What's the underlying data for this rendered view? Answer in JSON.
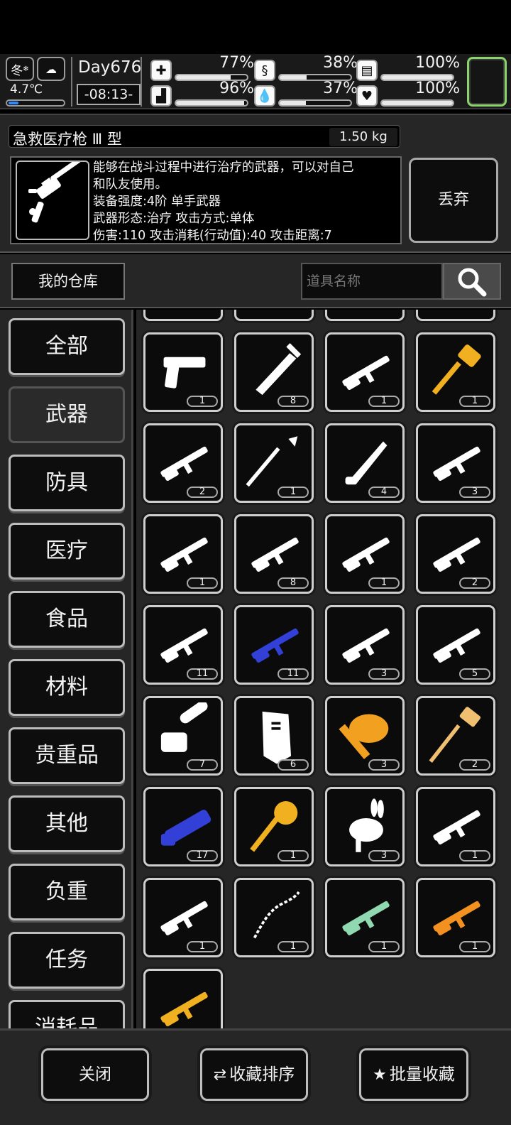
{
  "status": {
    "season": "冬",
    "temperature": "4.7℃",
    "day": "Day676",
    "time": "-08:13-",
    "stats": [
      {
        "icon": "medkit-icon",
        "glyph": "✚",
        "value": "77%",
        "level": 0.77
      },
      {
        "icon": "stomach-icon",
        "glyph": "§",
        "value": "38%",
        "level": 0.38
      },
      {
        "icon": "stamina-icon",
        "glyph": "▤",
        "value": "100%",
        "level": 1.0
      },
      {
        "icon": "boot-icon",
        "glyph": "▟",
        "value": "96%",
        "level": 0.96
      },
      {
        "icon": "water-drop-icon",
        "glyph": "💧",
        "value": "37%",
        "level": 0.37
      },
      {
        "icon": "heart-icon",
        "glyph": "♥",
        "value": "100%",
        "level": 1.0
      }
    ]
  },
  "item": {
    "name": "急救医疗枪 Ⅲ 型",
    "weight": "1.50 kg",
    "description": "能够在战斗过程中进行治疗的武器，可以对自己\n和队友使用。\n装备强度:4阶 单手武器\n武器形态:治疗 攻击方式:单体\n 伤害:110 攻击消耗(行动值):40 攻击距离:7",
    "discard_label": "丢弃"
  },
  "warehouse_label": "我的仓库",
  "search": {
    "placeholder": "道具名称"
  },
  "categories": [
    "全部",
    "武器",
    "防具",
    "医疗",
    "食品",
    "材料",
    "贵重品",
    "其他",
    "负重",
    "任务",
    "消耗品"
  ],
  "active_category": "武器",
  "items": [
    {
      "icon": "pistol-icon",
      "count": "1",
      "color": "#ffffff"
    },
    {
      "icon": "greatsword-icon",
      "count": "8",
      "color": "#ffffff"
    },
    {
      "icon": "rifle-icon",
      "count": "1",
      "color": "#ffffff"
    },
    {
      "icon": "golden-hammer-icon",
      "count": "1",
      "color": "#f0b020"
    },
    {
      "icon": "shotgun-icon",
      "count": "2",
      "color": "#ffffff"
    },
    {
      "icon": "spear-icon",
      "count": "1",
      "color": "#ffffff"
    },
    {
      "icon": "knife-icon",
      "count": "4",
      "color": "#ffffff"
    },
    {
      "icon": "assault-rifle-icon",
      "count": "3",
      "color": "#ffffff"
    },
    {
      "icon": "bolt-rifle-icon",
      "count": "1",
      "color": "#ffffff"
    },
    {
      "icon": "m4-rifle-icon",
      "count": "8",
      "color": "#ffffff"
    },
    {
      "icon": "smg-icon",
      "count": "1",
      "color": "#ffffff"
    },
    {
      "icon": "rocket-launcher-icon",
      "count": "2",
      "color": "#ffffff"
    },
    {
      "icon": "pump-shotgun-icon",
      "count": "11",
      "color": "#ffffff"
    },
    {
      "icon": "sniper-rifle-icon",
      "count": "11",
      "color": "#3340d8"
    },
    {
      "icon": "grenade-launcher-icon",
      "count": "3",
      "color": "#ffffff"
    },
    {
      "icon": "battle-rifle-icon",
      "count": "5",
      "color": "#ffffff"
    },
    {
      "icon": "chainsaw-icon",
      "count": "7",
      "color": "#ffffff"
    },
    {
      "icon": "riot-shield-icon",
      "count": "6",
      "color": "#ffffff"
    },
    {
      "icon": "flame-axe-icon",
      "count": "3",
      "color": "#f2a020"
    },
    {
      "icon": "sledgehammer-icon",
      "count": "2",
      "color": "#f0c070"
    },
    {
      "icon": "minigun-icon",
      "count": "17",
      "color": "#3340d8"
    },
    {
      "icon": "dragon-staff-icon",
      "count": "1",
      "color": "#f0b020"
    },
    {
      "icon": "rabbit-gun-icon",
      "count": "3",
      "color": "#ffffff"
    },
    {
      "icon": "scoped-rifle-icon",
      "count": "1",
      "color": "#ffffff"
    },
    {
      "icon": "ornate-sniper-icon",
      "count": "1",
      "color": "#ffffff"
    },
    {
      "icon": "chain-whip-icon",
      "count": "1",
      "color": "#ffffff"
    },
    {
      "icon": "jade-blaster-icon",
      "count": "1",
      "color": "#8fd8b0"
    },
    {
      "icon": "orange-blaster-icon",
      "count": "1",
      "color": "#f29020"
    },
    {
      "icon": "golden-rifle-icon",
      "count": "",
      "color": "#f0b020"
    }
  ],
  "bottom": {
    "close_label": "关闭",
    "sort_label": "收藏排序",
    "batch_label": "批量收藏"
  }
}
